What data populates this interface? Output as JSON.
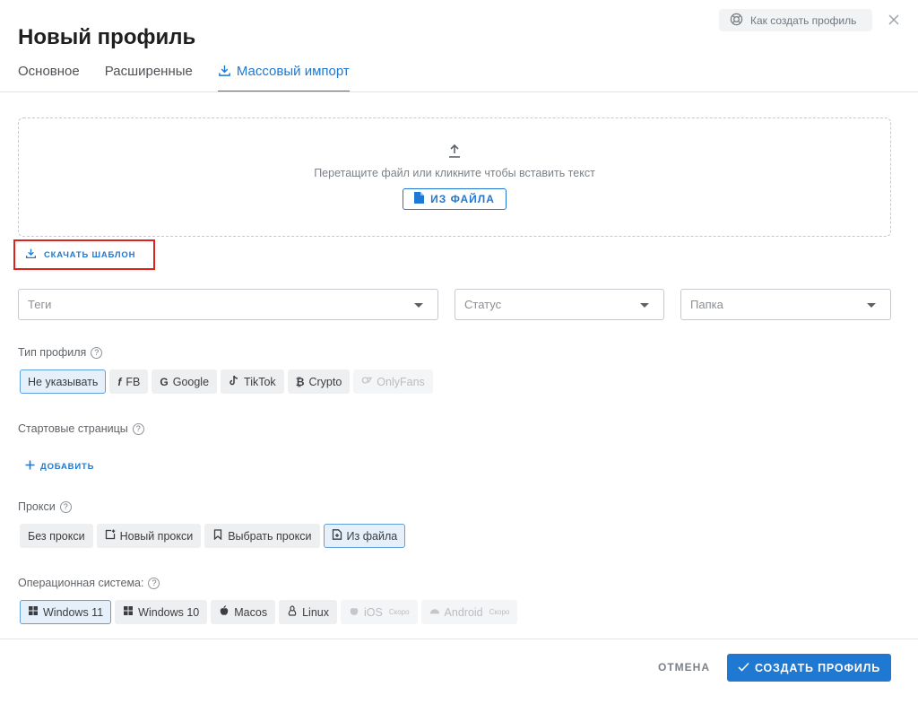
{
  "header": {
    "help_label": "Как создать профиль",
    "title": "Новый профиль"
  },
  "tabs": [
    {
      "label": "Основное"
    },
    {
      "label": "Расширенные"
    },
    {
      "label": "Массовый импорт",
      "active": true
    }
  ],
  "import": {
    "drop_text": "Перетащите файл или кликните чтобы вставить текст",
    "from_file_label": "ИЗ ФАЙЛА",
    "download_template_label": "СКАЧАТЬ ШАБЛОН"
  },
  "fields": {
    "tags_placeholder": "Теги",
    "status_placeholder": "Статус",
    "folder_placeholder": "Папка"
  },
  "profile_type": {
    "label": "Тип профиля",
    "options": [
      "Не указывать",
      "FB",
      "Google",
      "TikTok",
      "Crypto",
      "OnlyFans"
    ],
    "selected": "Не указывать"
  },
  "start_pages": {
    "label": "Стартовые страницы",
    "add_label": "ДОБАВИТЬ"
  },
  "proxy": {
    "label": "Прокси",
    "options": [
      "Без прокси",
      "Новый прокси",
      "Выбрать прокси",
      "Из файла"
    ],
    "selected": "Из файла"
  },
  "os": {
    "label": "Операционная система:",
    "options": [
      "Windows 11",
      "Windows 10",
      "Macos",
      "Linux",
      "iOS",
      "Android"
    ],
    "soon_label": "Скоро",
    "selected": "Windows 11"
  },
  "footer": {
    "cancel_label": "ОТМЕНА",
    "create_label": "СОЗДАТЬ ПРОФИЛЬ"
  },
  "colors": {
    "accent": "#1f78d1",
    "highlight_box": "#e0201a"
  }
}
